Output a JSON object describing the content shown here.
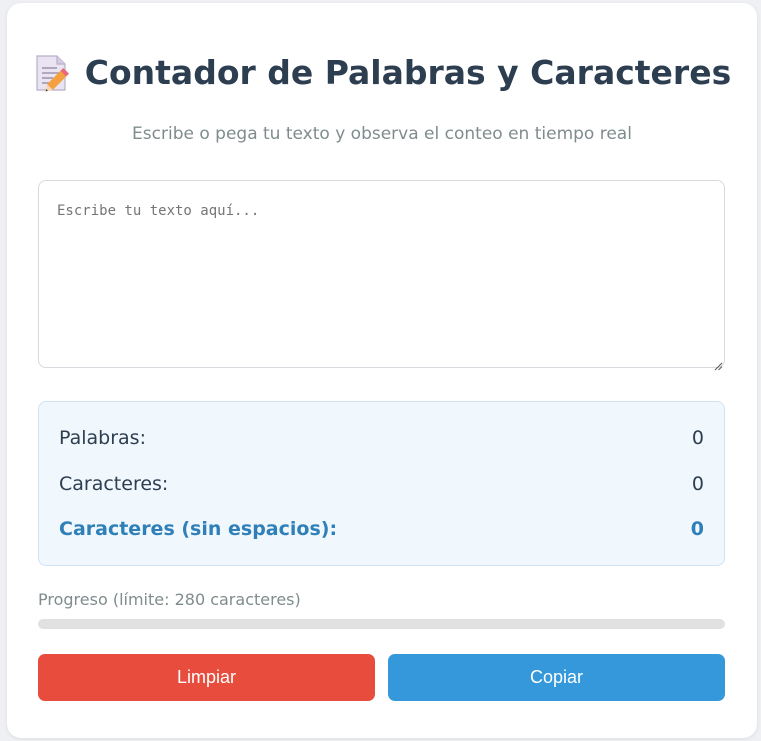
{
  "header": {
    "icon": "memo-pencil-icon",
    "title": "Contador de Palabras y Caracteres",
    "subtitle": "Escribe o pega tu texto y observa el conteo en tiempo real"
  },
  "editor": {
    "value": "",
    "placeholder": "Escribe tu texto aquí..."
  },
  "stats": {
    "words_label": "Palabras:",
    "words_value": "0",
    "chars_label": "Caracteres:",
    "chars_value": "0",
    "chars_nospace_label": "Caracteres (sin espacios):",
    "chars_nospace_value": "0"
  },
  "progress": {
    "label": "Progreso (límite: 280 caracteres)",
    "fraction": 0
  },
  "actions": {
    "clear_label": "Limpiar",
    "copy_label": "Copiar"
  },
  "colors": {
    "title": "#2c3e50",
    "accent_blue": "#3498db",
    "danger_red": "#e74c3c",
    "highlight_text": "#2f80b9"
  }
}
